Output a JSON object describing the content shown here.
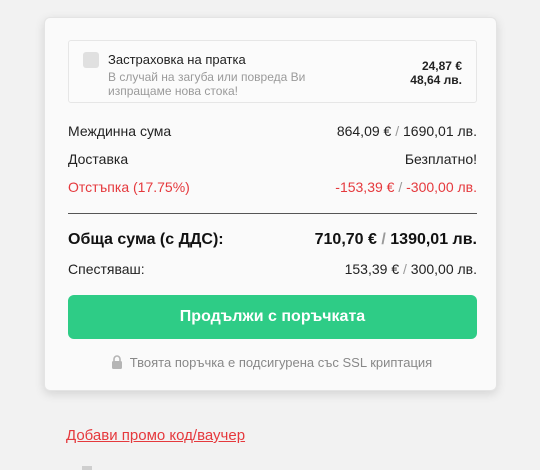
{
  "insurance": {
    "title": "Застраховка на пратка",
    "description": "В случай на загуба или повреда Ви изпращаме нова стока!",
    "price_eur": "24,87 €",
    "price_bgn": "48,64 лв.",
    "checked": false
  },
  "summary": {
    "subtotal": {
      "label": "Междинна сума",
      "eur": "864,09 €",
      "bgn": "1690,01 лв."
    },
    "shipping": {
      "label": "Доставка",
      "value": "Безплатно!"
    },
    "discount": {
      "label": "Отстъпка (17.75%)",
      "eur": "-153,39 €",
      "bgn": "-300,00 лв."
    },
    "total": {
      "label": "Обща сума (с ДДС):",
      "eur": "710,70 €",
      "bgn": "1390,01 лв."
    },
    "savings": {
      "label": "Спестяваш:",
      "eur": "153,39 €",
      "bgn": "300,00 лв."
    },
    "separator": "/"
  },
  "checkout": {
    "button_label": "Продължи с поръчката",
    "ssl_note": "Твоята поръчка е подсигурена със SSL криптация"
  },
  "promo": {
    "link_label": "Добави промо код/ваучер"
  },
  "colors": {
    "accent_green": "#2ecc86",
    "discount_red": "#e5393d"
  },
  "icons": {
    "ssl": "lock-icon"
  }
}
